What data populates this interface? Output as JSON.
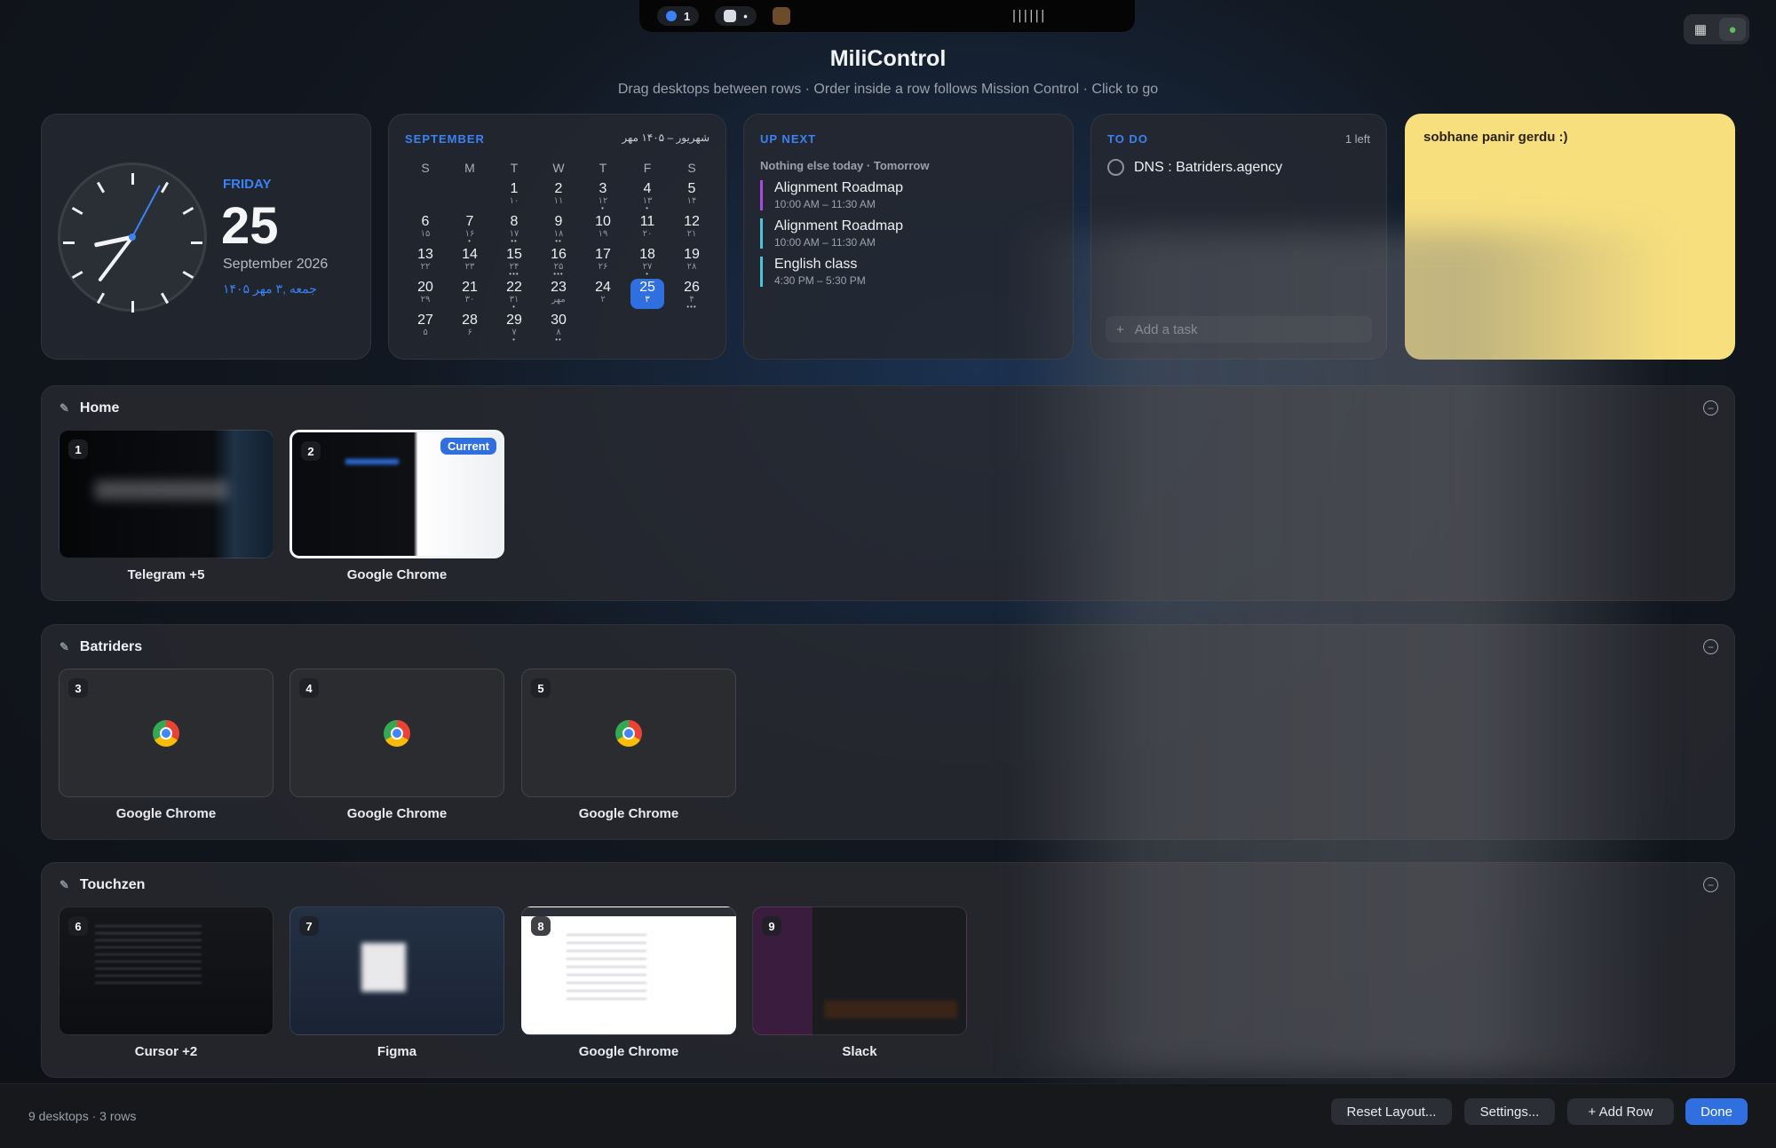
{
  "topbar": {
    "pill_count": "1",
    "pill_dot": "•",
    "bars": "||||||"
  },
  "header": {
    "title": "MiliControl",
    "subtitle": "Drag desktops between rows · Order inside a row follows Mission Control · Click to go"
  },
  "clock": {
    "day": "FRIDAY",
    "date_num": "25",
    "month_year": "September 2026",
    "persian": "جمعه ,۳ مهر ۱۴۰۵"
  },
  "calendar": {
    "month": "SEPTEMBER",
    "persian_header": "شهریور – ۱۴۰۵ مهر",
    "weekday_headers": [
      "S",
      "M",
      "T",
      "W",
      "T",
      "F",
      "S"
    ],
    "cells": [
      {
        "d": "",
        "p": "",
        "dots": ""
      },
      {
        "d": "",
        "p": "",
        "dots": ""
      },
      {
        "d": "1",
        "p": "۱۰",
        "dots": ""
      },
      {
        "d": "2",
        "p": "۱۱",
        "dots": ""
      },
      {
        "d": "3",
        "p": "۱۲",
        "dots": "•"
      },
      {
        "d": "4",
        "p": "۱۳",
        "dots": "•"
      },
      {
        "d": "5",
        "p": "۱۴",
        "dots": ""
      },
      {
        "d": "6",
        "p": "۱۵",
        "dots": ""
      },
      {
        "d": "7",
        "p": "۱۶",
        "dots": "•"
      },
      {
        "d": "8",
        "p": "۱۷",
        "dots": "••"
      },
      {
        "d": "9",
        "p": "۱۸",
        "dots": "••"
      },
      {
        "d": "10",
        "p": "۱۹",
        "dots": ""
      },
      {
        "d": "11",
        "p": "۲۰",
        "dots": ""
      },
      {
        "d": "12",
        "p": "۲۱",
        "dots": ""
      },
      {
        "d": "13",
        "p": "۲۲",
        "dots": ""
      },
      {
        "d": "14",
        "p": "۲۳",
        "dots": ""
      },
      {
        "d": "15",
        "p": "۲۴",
        "dots": "•••"
      },
      {
        "d": "16",
        "p": "۲۵",
        "dots": "•••"
      },
      {
        "d": "17",
        "p": "۲۶",
        "dots": ""
      },
      {
        "d": "18",
        "p": "۲۷",
        "dots": "•"
      },
      {
        "d": "19",
        "p": "۲۸",
        "dots": ""
      },
      {
        "d": "20",
        "p": "۲۹",
        "dots": ""
      },
      {
        "d": "21",
        "p": "۳۰",
        "dots": ""
      },
      {
        "d": "22",
        "p": "۳۱",
        "dots": "•"
      },
      {
        "d": "23",
        "p": "مهر",
        "dots": ""
      },
      {
        "d": "24",
        "p": "۲",
        "dots": ""
      },
      {
        "d": "25",
        "p": "۳",
        "dots": "•",
        "today": true
      },
      {
        "d": "26",
        "p": "۴",
        "dots": "•••"
      },
      {
        "d": "27",
        "p": "۵",
        "dots": ""
      },
      {
        "d": "28",
        "p": "۶",
        "dots": ""
      },
      {
        "d": "29",
        "p": "۷",
        "dots": "•"
      },
      {
        "d": "30",
        "p": "۸",
        "dots": "••"
      },
      {
        "d": "",
        "p": "",
        "dots": ""
      },
      {
        "d": "",
        "p": "",
        "dots": ""
      },
      {
        "d": "",
        "p": "",
        "dots": ""
      }
    ]
  },
  "upnext": {
    "heading": "UP NEXT",
    "subheading": "Nothing else today · Tomorrow",
    "events": [
      {
        "title": "Alignment Roadmap",
        "time": "10:00 AM – 11:30 AM",
        "color": "#a64bdc"
      },
      {
        "title": "Alignment Roadmap",
        "time": "10:00 AM – 11:30 AM",
        "color": "#4fc3d9"
      },
      {
        "title": "English class",
        "time": "4:30 PM – 5:30 PM",
        "color": "#4fc3d9"
      }
    ]
  },
  "todo": {
    "heading": "TO DO",
    "left_count": "1 left",
    "items": [
      "DNS : Batriders.agency"
    ],
    "add_label": "Add a task",
    "add_icon": "+"
  },
  "note": {
    "text": "sobhane panir gerdu :)"
  },
  "rows": [
    {
      "name": "Home",
      "desktops": [
        {
          "num": "1",
          "label": "Telegram +5",
          "current": false,
          "style": "dark-blur",
          "icon": ""
        },
        {
          "num": "2",
          "label": "Google Chrome",
          "current": true,
          "style": "split",
          "icon": ""
        }
      ]
    },
    {
      "name": "Batriders",
      "desktops": [
        {
          "num": "3",
          "label": "Google Chrome",
          "current": false,
          "style": "empty",
          "icon": "chrome-icon"
        },
        {
          "num": "4",
          "label": "Google Chrome",
          "current": false,
          "style": "empty",
          "icon": "chrome-icon"
        },
        {
          "num": "5",
          "label": "Google Chrome",
          "current": false,
          "style": "empty",
          "icon": "chrome-icon"
        }
      ]
    },
    {
      "name": "Touchzen",
      "desktops": [
        {
          "num": "6",
          "label": "Cursor +2",
          "current": false,
          "style": "dark-code",
          "icon": ""
        },
        {
          "num": "7",
          "label": "Figma",
          "current": false,
          "style": "figma",
          "icon": ""
        },
        {
          "num": "8",
          "label": "Google Chrome",
          "current": false,
          "style": "white",
          "icon": ""
        },
        {
          "num": "9",
          "label": "Slack",
          "current": false,
          "style": "slack",
          "icon": ""
        }
      ]
    }
  ],
  "current_badge": "Current",
  "footer": {
    "summary": "9 desktops · 3 rows",
    "reset": "Reset Layout...",
    "settings": "Settings...",
    "add_row": "+ Add Row",
    "done": "Done"
  },
  "colors": {
    "accent": "#2f6fe0",
    "note_bg": "#f7df7e"
  }
}
